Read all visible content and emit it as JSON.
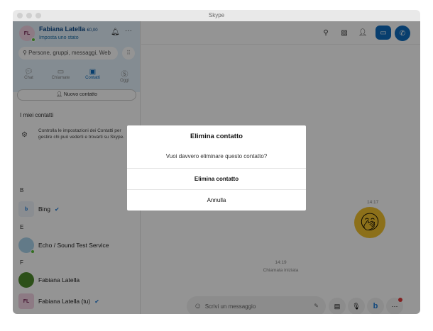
{
  "window": {
    "title": "Skype"
  },
  "profile": {
    "initials": "FL",
    "name": "Fabiana Latella",
    "credit": "€0,00",
    "status": "Imposta uno stato"
  },
  "search": {
    "placeholder": "Persone, gruppi, messaggi, Web"
  },
  "tabs": [
    {
      "label": "Chat"
    },
    {
      "label": "Chiamate"
    },
    {
      "label": "Contatti"
    },
    {
      "label": "Oggi"
    }
  ],
  "new_contact": "Nuovo contatto",
  "my_contacts": "I miei contatti",
  "info": "Controlla le impostazioni dei Contatti per gestire chi può vederti e trovarti su Skype.",
  "groups": [
    {
      "letter": "B",
      "contacts": [
        {
          "name": "Bing"
        }
      ]
    },
    {
      "letter": "E",
      "contacts": [
        {
          "name": "Echo / Sound Test Service"
        }
      ]
    },
    {
      "letter": "F",
      "contacts": [
        {
          "name": "Fabiana Latella"
        },
        {
          "name": "Fabiana Latella (tu)",
          "initials": "FL"
        }
      ]
    }
  ],
  "chat": {
    "time1": "14:17",
    "time2": "14:19",
    "call_started": "Chiamata iniziata",
    "input_placeholder": "Scrivi un messaggio"
  },
  "dialog": {
    "title": "Elimina contatto",
    "message": "Vuoi davvero eliminare questo contatto?",
    "confirm": "Elimina contatto",
    "cancel": "Annulla"
  },
  "colors": {
    "accent": "#0f6cbd"
  }
}
